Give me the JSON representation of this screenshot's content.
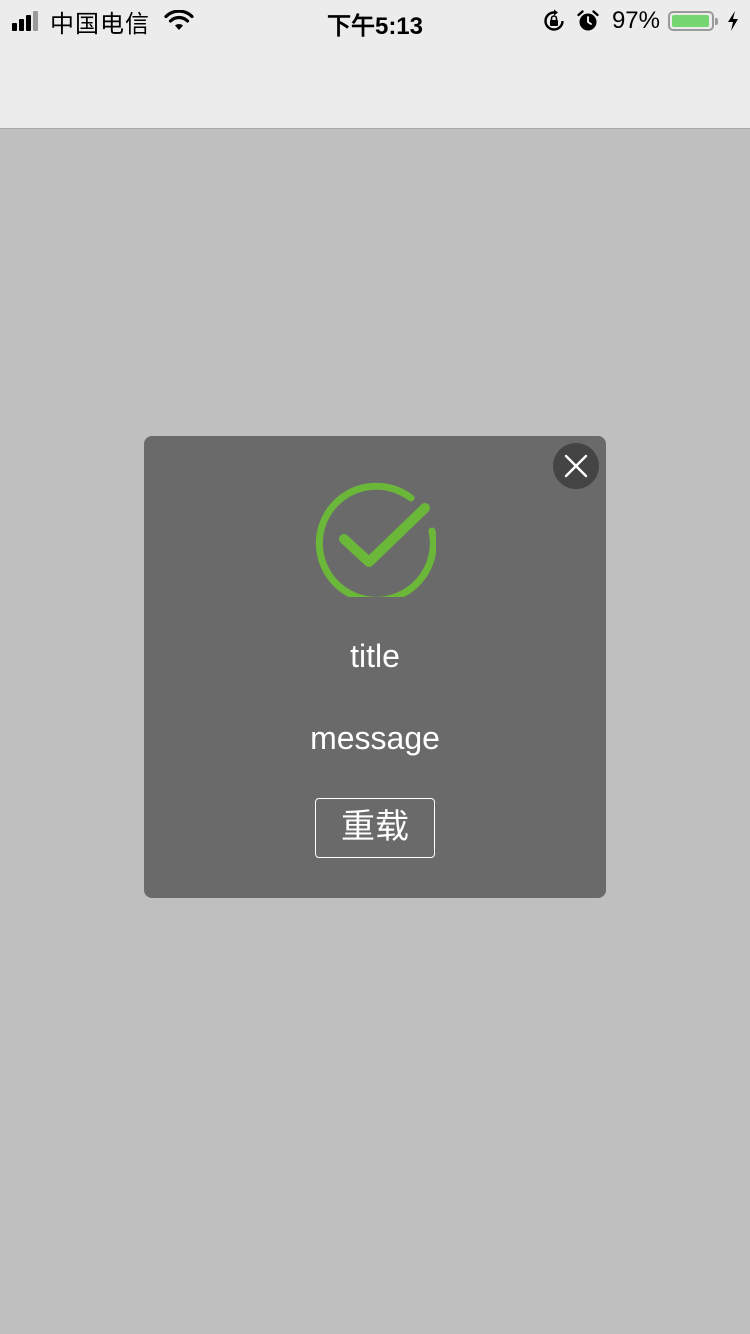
{
  "status_bar": {
    "carrier": "中国电信",
    "time": "下午5:13",
    "battery_percent": "97%",
    "battery_level": 0.97,
    "signal_bars": 3,
    "icons": [
      "signal-icon",
      "wifi-icon",
      "orientation-lock-icon",
      "alarm-icon",
      "battery-icon",
      "charging-bolt-icon"
    ]
  },
  "dialog": {
    "icon": "success-check-icon",
    "title": "title",
    "message": "message",
    "reload_label": "重载",
    "close_icon": "close-icon"
  },
  "colors": {
    "page_background": "#bfbfbf",
    "nav_background": "#ececec",
    "dialog_background": "#6a6a6a",
    "close_button_background": "#444444",
    "success_green": "#6ab73a",
    "battery_green": "#76d672",
    "text_on_dialog": "#ffffff"
  }
}
